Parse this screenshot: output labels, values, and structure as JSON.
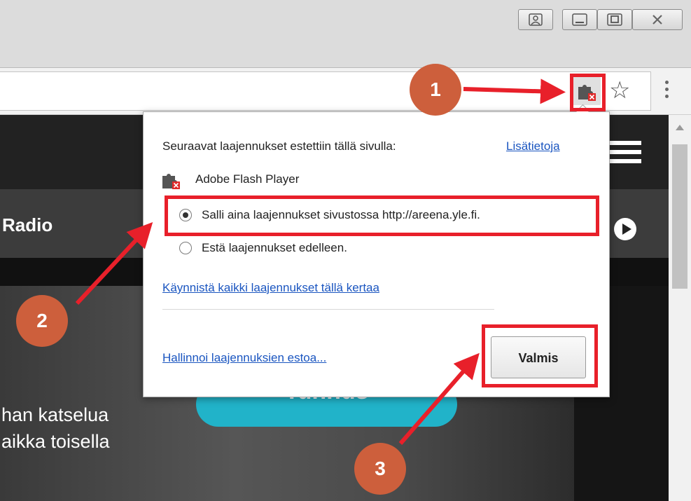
{
  "colors": {
    "highlight": "#e8202a",
    "badge": "#cd5f3c",
    "accent_button": "#21b3c9",
    "link": "#1a55c0"
  },
  "window_controls": {
    "profile_icon": "person-icon",
    "minimize_icon": "minimize-icon",
    "maximize_icon": "maximize-icon",
    "close_icon": "close-icon"
  },
  "toolbar": {
    "extension_icon": "puzzle-blocked-icon",
    "bookmark_icon": "star-icon",
    "menu_icon": "kebab-menu-icon"
  },
  "page": {
    "nav_label": "Radio",
    "cta_label": "Tunnus",
    "hero_line1": "han katselua",
    "hero_line2": "aikka toisella"
  },
  "popup": {
    "heading": "Seuraavat laajennukset estettiin tällä sivulla:",
    "more_info_link": "Lisätietoja",
    "plugin_name": "Adobe Flash Player",
    "option_allow": "Salli aina laajennukset sivustossa http://areena.yle.fi.",
    "option_block": "Estä laajennukset edelleen.",
    "run_once_link": "Käynnistä kaikki laajennukset tällä kertaa",
    "manage_link": "Hallinnoi laajennuksien estoa...",
    "done_button": "Valmis"
  },
  "annotations": {
    "badge1": "1",
    "badge2": "2",
    "badge3": "3"
  }
}
